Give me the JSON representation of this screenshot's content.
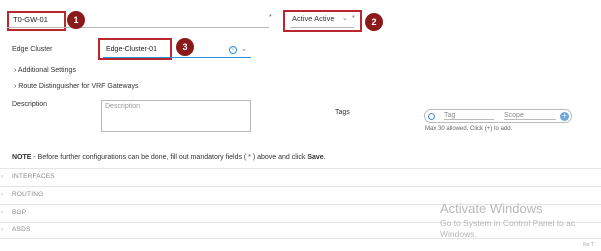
{
  "name_field": {
    "value": "T0-GW-01",
    "required_mark": "*"
  },
  "ha_mode": {
    "value": "Active Active",
    "required_mark": "*"
  },
  "callouts": [
    "1",
    "2",
    "3"
  ],
  "edge_cluster": {
    "label": "Edge Cluster",
    "value": "Edge-Cluster-01"
  },
  "sections": {
    "additional": "Additional Settings",
    "route_distinguisher": "Route Distinguisher for VRF Gateways"
  },
  "description": {
    "label": "Description",
    "placeholder": "Description"
  },
  "tags": {
    "label": "Tags",
    "tag_placeholder": "Tag",
    "scope_placeholder": "Scope",
    "hint": "Max 30 allowed. Click (+) to add."
  },
  "note": {
    "bold_prefix": "NOTE",
    "text": " - Before further configurations can be done, fill out mandatory fields ( * ) above and click ",
    "save": "Save",
    "end": "."
  },
  "collapsibles": [
    "INTERFACES",
    "ROUTING",
    "BGP",
    "ASDS"
  ],
  "watermark": {
    "title": "Activate Windows",
    "line1": "Go to System in Control Panel to ac",
    "line2": "Windows."
  },
  "footer_fragment": "No T",
  "colors": {
    "callout_bg": "#8b1a1a",
    "callout_box": "#b8282e",
    "focus_line": "#2f8fd8"
  }
}
